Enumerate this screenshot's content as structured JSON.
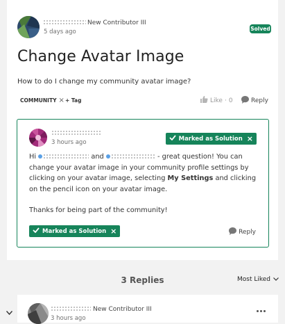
{
  "post": {
    "author_role": "New Contributor III",
    "time_ago": "5 days ago",
    "status_badge": "Solved",
    "title": "Change Avatar Image",
    "body": "How to do I change my community avatar image?",
    "tags": [
      {
        "label": "COMMUNITY"
      }
    ],
    "add_tag_label": "+ Tag",
    "like_label": "Like",
    "like_count": "0",
    "like_separator": "·",
    "reply_label": "Reply"
  },
  "solution": {
    "time_ago": "3 hours ago",
    "marked_label": "Marked as Solution",
    "text": {
      "hi": "Hi",
      "and": "and",
      "rest_1": "- great question! You can change your avatar image in your community profile settings by clicking on your avatar image, selecting",
      "bold": "My Settings",
      "rest_2": "and clicking on the pencil icon on your avatar image.",
      "thanks": "Thanks for being part of the community!"
    },
    "reply_label": "Reply"
  },
  "replies": {
    "count_label": "3 Replies",
    "sort_label": "Most Liked"
  },
  "first_reply": {
    "author_role": "New Contributor III",
    "time_ago": "3 hours ago"
  },
  "colors": {
    "accent_green": "#16845a",
    "mention_blue": "#5aa0e6"
  }
}
